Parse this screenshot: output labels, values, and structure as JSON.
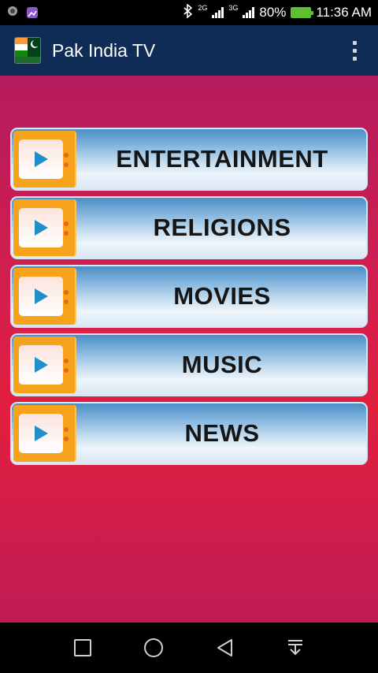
{
  "status_bar": {
    "network_1": "2G",
    "network_2": "3G",
    "battery_percent": "80%",
    "time": "11:36 AM",
    "left_icons": [
      "camera-icon",
      "gallery-icon"
    ],
    "right_icons": [
      "bluetooth-icon",
      "signal-icon",
      "signal-icon",
      "battery-charging-icon"
    ]
  },
  "app_bar": {
    "title": "Pak India TV",
    "logo_icon": "pak-india-flag-icon",
    "menu_icon": "overflow-menu-icon"
  },
  "categories": [
    {
      "label": "ENTERTAINMENT",
      "icon": "tv-play-icon"
    },
    {
      "label": "RELIGIONS",
      "icon": "tv-play-icon"
    },
    {
      "label": "MOVIES",
      "icon": "tv-play-icon"
    },
    {
      "label": "MUSIC",
      "icon": "tv-play-icon"
    },
    {
      "label": "NEWS",
      "icon": "tv-play-icon"
    }
  ],
  "nav_bar": {
    "buttons": [
      "recents-square-icon",
      "home-circle-icon",
      "back-triangle-icon",
      "notification-pull-icon"
    ]
  },
  "colors": {
    "app_bar": "#0f2c56",
    "tv_icon": "#f7a21b",
    "play": "#1f8fc9",
    "background_top": "#b51b5e",
    "background_mid": "#e21f3e"
  }
}
